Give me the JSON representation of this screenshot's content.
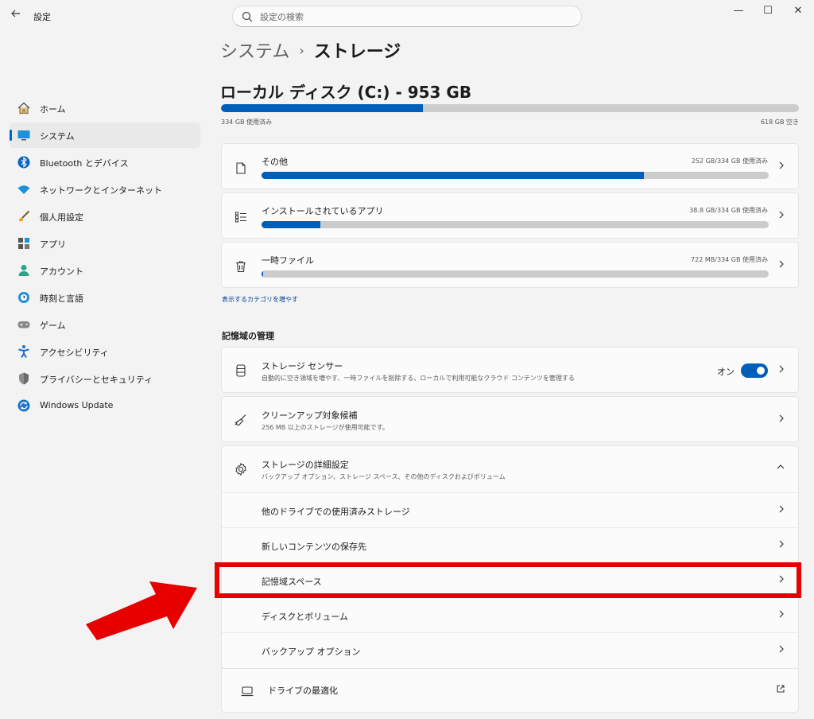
{
  "window": {
    "title": "設定",
    "minimize": "—",
    "maximize": "☐",
    "close": "✕"
  },
  "search": {
    "placeholder": "設定の検索"
  },
  "sidebar": {
    "items": [
      {
        "label": "ホーム",
        "icon": "home-icon"
      },
      {
        "label": "システム",
        "icon": "system-display-icon",
        "active": true
      },
      {
        "label": "Bluetooth とデバイス",
        "icon": "bluetooth-icon"
      },
      {
        "label": "ネットワークとインターネット",
        "icon": "wifi-icon"
      },
      {
        "label": "個人用設定",
        "icon": "brush-icon"
      },
      {
        "label": "アプリ",
        "icon": "apps-icon"
      },
      {
        "label": "アカウント",
        "icon": "account-icon"
      },
      {
        "label": "時刻と言語",
        "icon": "globe-clock-icon"
      },
      {
        "label": "ゲーム",
        "icon": "gamepad-icon"
      },
      {
        "label": "アクセシビリティ",
        "icon": "accessibility-icon"
      },
      {
        "label": "プライバシーとセキュリティ",
        "icon": "shield-icon"
      },
      {
        "label": "Windows Update",
        "icon": "windows-update-icon"
      }
    ]
  },
  "breadcrumb": {
    "parent": "システム",
    "separator": "›",
    "current": "ストレージ"
  },
  "disk": {
    "title": "ローカル ディスク (C:) - 953 GB",
    "used_label": "334 GB 使用済み",
    "free_label": "618 GB 空き",
    "used_fraction": 0.35
  },
  "categories": [
    {
      "title": "その他",
      "usage": "252 GB/334 GB 使用済み",
      "fraction": 0.754,
      "icon": "document-icon"
    },
    {
      "title": "インストールされているアプリ",
      "usage": "38.8 GB/334 GB 使用済み",
      "fraction": 0.116,
      "icon": "app-list-icon"
    },
    {
      "title": "一時ファイル",
      "usage": "722 MB/334 GB 使用済み",
      "fraction": 0.003,
      "icon": "trash-icon"
    }
  ],
  "show_more_link": "表示するカテゴリを増やす",
  "management": {
    "heading": "記憶域の管理",
    "sense": {
      "title": "ストレージ センサー",
      "subtitle": "自動的に空き領域を増やす、一時ファイルを削除する、ローカルで利用可能なクラウド コンテンツを管理する",
      "toggle_label": "オン",
      "toggle_on": true
    },
    "cleanup": {
      "title": "クリーンアップ対象候補",
      "subtitle": "256 MB 以上のストレージが使用可能です。"
    },
    "advanced": {
      "title": "ストレージの詳細設定",
      "subtitle": "バックアップ オプション、ストレージ スペース、その他のディスクおよびボリューム",
      "expanded": true,
      "items": [
        "他のドライブでの使用済みストレージ",
        "新しいコンテンツの保存先",
        "記憶域スペース",
        "ディスクとボリューム",
        "バックアップ オプション"
      ]
    },
    "optimize": {
      "title": "ドライブの最適化"
    }
  },
  "colors": {
    "accent": "#005fb8",
    "highlight": "#e60000",
    "track": "#cccccc"
  }
}
